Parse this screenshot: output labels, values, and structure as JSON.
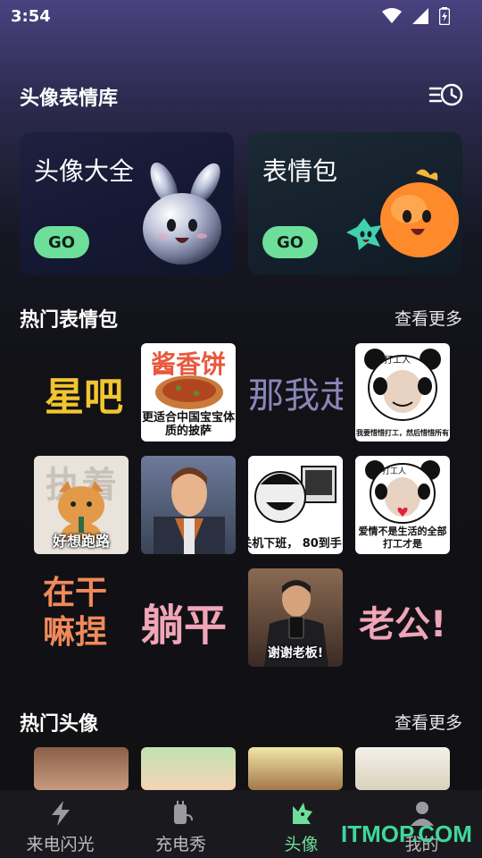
{
  "status": {
    "time": "3:54"
  },
  "header": {
    "title": "头像表情库"
  },
  "cards": [
    {
      "title": "头像大全",
      "button": "GO"
    },
    {
      "title": "表情包",
      "button": "GO"
    }
  ],
  "hot_stickers": {
    "title": "热门表情包",
    "more": "查看更多",
    "items": [
      {
        "text": "星吧"
      },
      {
        "banner": "酱香饼",
        "caption": "更适合中国宝宝体质的披萨"
      },
      {
        "text": "那我走"
      },
      {
        "badge": "打工人",
        "caption": "我要惜惜打工，然后惜惜所有"
      },
      {
        "banner": "执着",
        "caption": "好想跑路"
      },
      {
        "caption": ""
      },
      {
        "caption": "关机下班， 80到手"
      },
      {
        "badge": "打工人",
        "caption": "爱情不是生活的全部打工才是"
      },
      {
        "text": "在干嘛捏"
      },
      {
        "text": "躺平"
      },
      {
        "caption": "谢谢老板!"
      },
      {
        "text": "老公!!"
      }
    ]
  },
  "hot_avatars": {
    "title": "热门头像",
    "more": "查看更多"
  },
  "tabs": [
    {
      "label": "来电闪光",
      "icon": "lightning-icon"
    },
    {
      "label": "充电秀",
      "icon": "charger-icon"
    },
    {
      "label": "头像",
      "icon": "avatar-icon"
    },
    {
      "label": "我的",
      "icon": "profile-icon"
    }
  ],
  "watermark": "ITMOP.COM",
  "colors": {
    "accent": "#6ddf9a",
    "background": "#111114"
  }
}
